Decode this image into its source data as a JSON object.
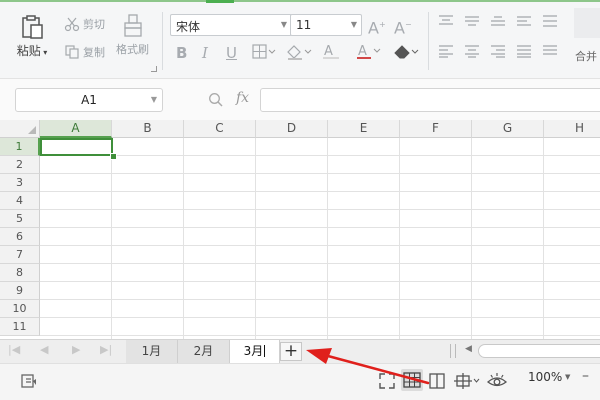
{
  "ribbon": {
    "paste_label": "粘贴",
    "cut_label": "剪切",
    "copy_label": "复制",
    "format_painter_label": "格式刷",
    "font_name": "宋体",
    "font_size": "11",
    "merge_label": "合并",
    "accent_color": "#4caf50"
  },
  "formula_bar": {
    "name_box": "A1",
    "fx_label": "fx",
    "formula_value": ""
  },
  "grid": {
    "columns": [
      "A",
      "B",
      "C",
      "D",
      "E",
      "F",
      "G",
      "H"
    ],
    "rows": [
      "1",
      "2",
      "3",
      "4",
      "5",
      "6",
      "7",
      "8",
      "9",
      "10",
      "11"
    ],
    "active_cell": "A1",
    "active_color": "#3f8f3a"
  },
  "sheets": {
    "tabs": [
      "1月",
      "2月",
      "3月"
    ],
    "active_tab": "3月",
    "add_label": "+"
  },
  "status_bar": {
    "zoom_level": "100%",
    "zoom_minus": "–"
  },
  "annotation": {
    "arrow_color": "#e0201c",
    "points_to": "add-sheet-button"
  }
}
